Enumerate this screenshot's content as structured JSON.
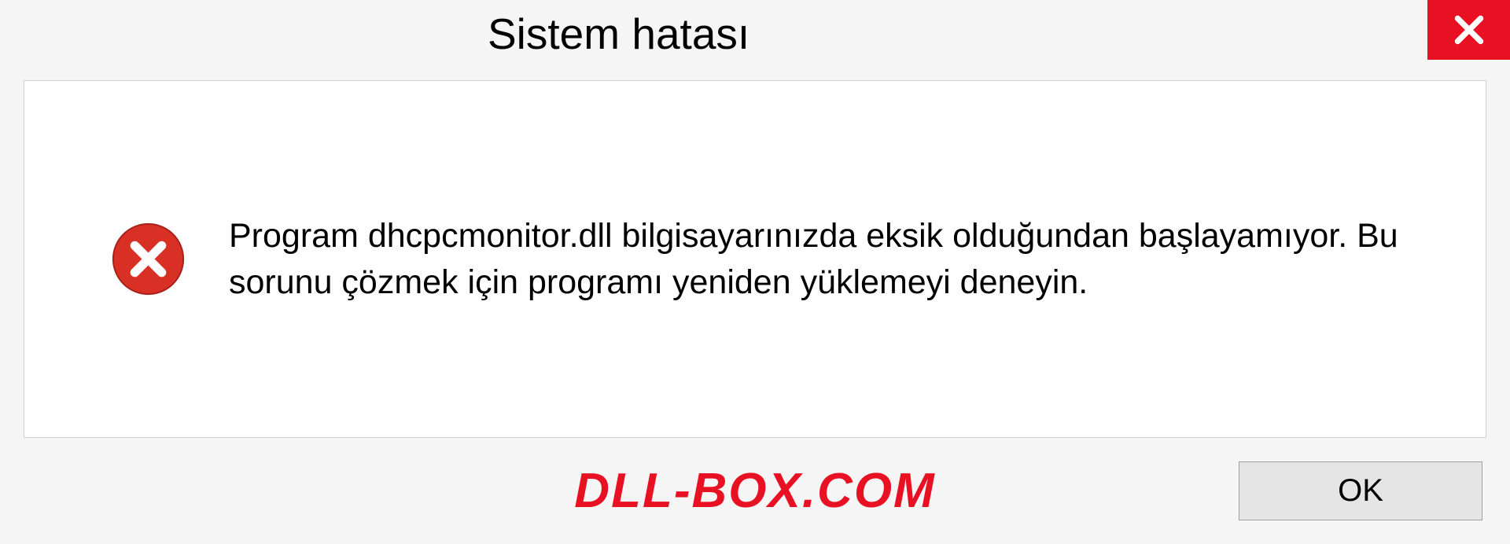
{
  "dialog": {
    "title": "Sistem hatası",
    "message": "Program dhcpcmonitor.dll bilgisayarınızda eksik olduğundan başlayamıyor. Bu sorunu çözmek için programı yeniden yüklemeyi deneyin.",
    "ok_label": "OK"
  },
  "watermark": "DLL-BOX.COM",
  "icons": {
    "close": "close-icon",
    "error": "error-icon"
  },
  "colors": {
    "close_bg": "#e81123",
    "watermark": "#e81123",
    "panel_bg": "#ffffff",
    "dialog_bg": "#f5f5f5"
  }
}
